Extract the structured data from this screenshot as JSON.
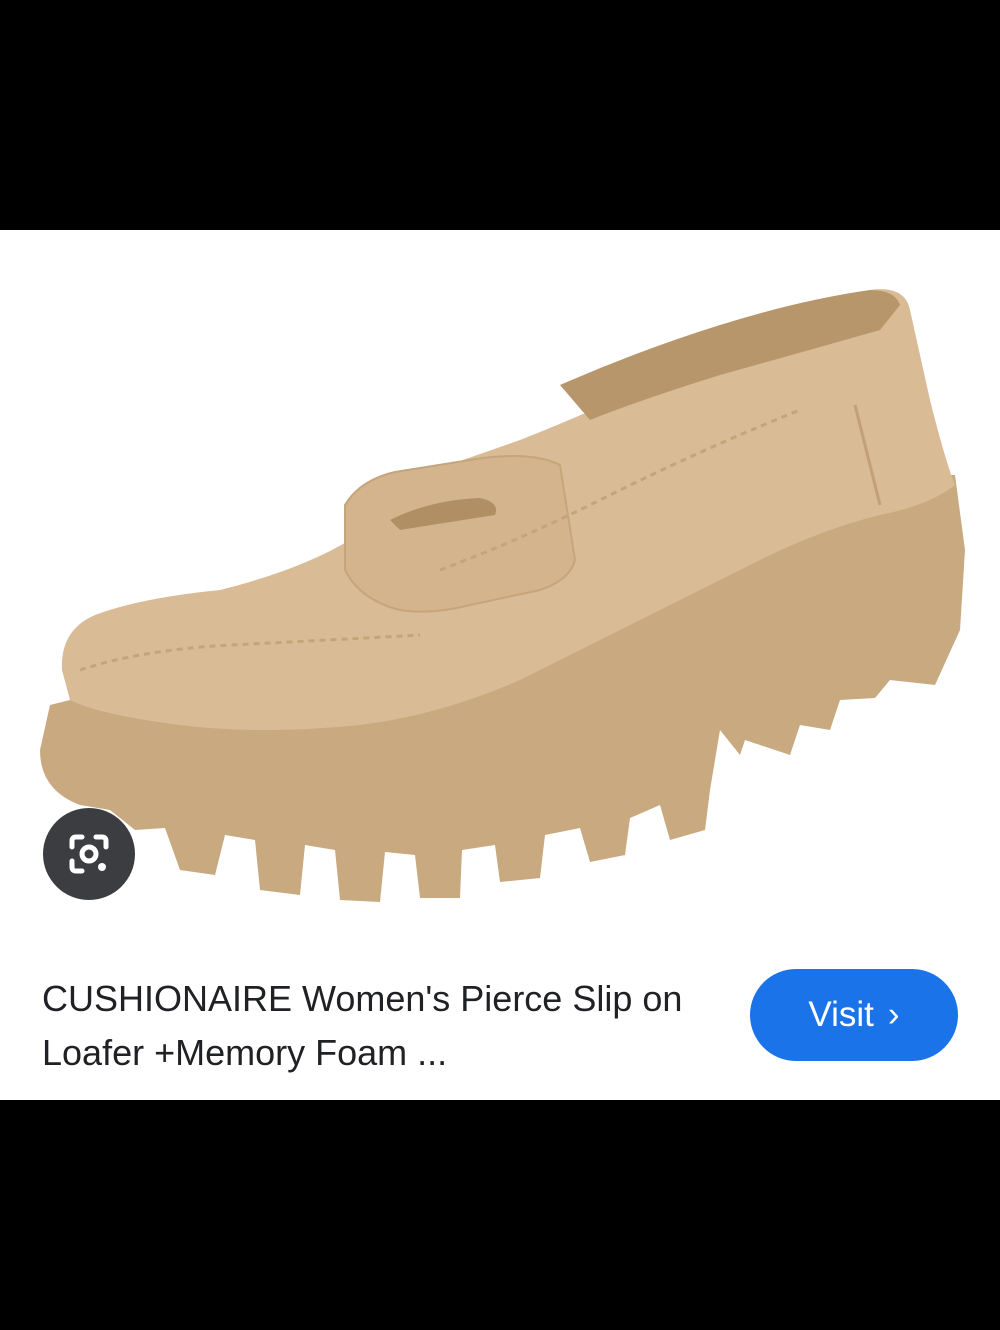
{
  "result": {
    "title": "CUSHIONAIRE Women's Pierce Slip on Loafer +Memory Foam ...",
    "visit_label": "Visit",
    "visit_chevron": "›"
  },
  "icons": {
    "lens": "google-lens-icon",
    "chevron": "chevron-right-icon"
  },
  "colors": {
    "visit_button": "#1a73e8",
    "lens_button": "#3c3d40",
    "shoe": "#d9bb95"
  }
}
